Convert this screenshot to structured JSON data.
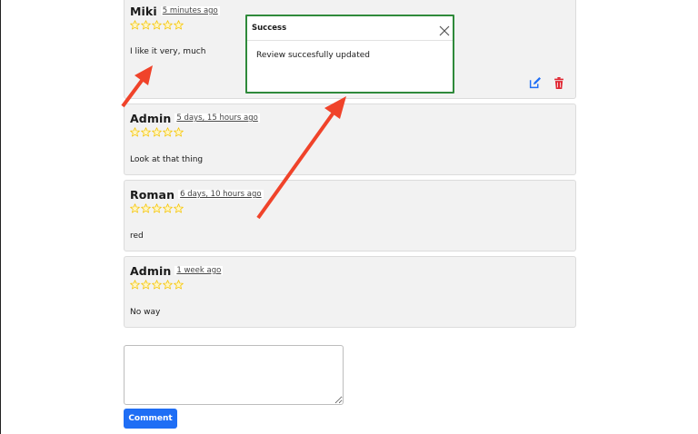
{
  "reviews": [
    {
      "author": "Miki",
      "time": "5 minutes ago",
      "rating": 5,
      "text": "I like it very, much"
    },
    {
      "author": "Admin",
      "time": "5 days, 15 hours ago",
      "rating": 5,
      "text": "Look at that thing"
    },
    {
      "author": "Roman",
      "time": "6 days, 10 hours ago",
      "rating": 5,
      "text": "red"
    },
    {
      "author": "Admin",
      "time": "1 week ago",
      "rating": 5,
      "text": "No way"
    }
  ],
  "actions": {
    "edit_icon": "edit-icon",
    "delete_icon": "trash-icon"
  },
  "comment": {
    "value": "",
    "button_label": "Comment"
  },
  "toast": {
    "title": "Success",
    "message": "Review succesfully updated",
    "border_color": "#2f8a3b"
  },
  "colors": {
    "accent": "#1f6ef5",
    "delete": "#e0242f",
    "star": "#f5c400",
    "annotation_arrow": "#f0432a"
  }
}
